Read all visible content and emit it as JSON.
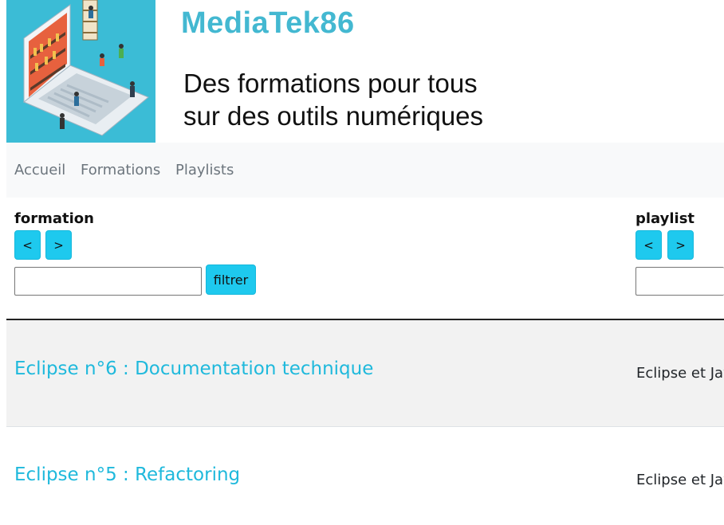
{
  "header": {
    "brand": "MediaTek86",
    "tagline_line1": "Des formations pour tous",
    "tagline_line2": "sur des outils numériques",
    "logo_icon": "laptop-library-illustration-icon"
  },
  "nav": {
    "items": [
      {
        "label": "Accueil"
      },
      {
        "label": "Formations"
      },
      {
        "label": "Playlists"
      }
    ]
  },
  "filters": {
    "formation": {
      "label": "formation",
      "sort_asc": "<",
      "sort_desc": ">",
      "input_value": "",
      "button_label": "filtrer"
    },
    "playlist": {
      "label": "playlist",
      "sort_asc": "<",
      "sort_desc": ">",
      "input_value": ""
    }
  },
  "rows": [
    {
      "title": "Eclipse n°6 : Documentation technique",
      "playlist": "Eclipse et Jav"
    },
    {
      "title": "Eclipse n°5 : Refactoring",
      "playlist": "Eclipse et Jav"
    }
  ],
  "colors": {
    "accent": "#1ec9ee",
    "link": "#1fb9dc",
    "brand": "#43b8d1",
    "navbar_bg": "#f8f9fa",
    "stripe": "#f2f2f2"
  }
}
